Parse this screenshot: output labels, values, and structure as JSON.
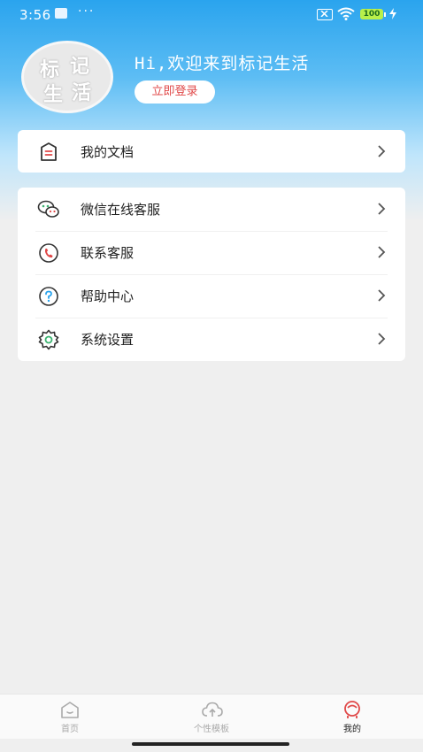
{
  "status_bar": {
    "time": "3:56",
    "dots": "···",
    "battery": "100"
  },
  "header": {
    "avatar_text": [
      "标",
      "记",
      "生",
      "活"
    ],
    "greeting": "Hi,欢迎来到标记生活",
    "login_label": "立即登录"
  },
  "card1": {
    "items": [
      {
        "label": "我的文档",
        "icon": "document-icon"
      }
    ]
  },
  "card2": {
    "items": [
      {
        "label": "微信在线客服",
        "icon": "wechat-icon"
      },
      {
        "label": "联系客服",
        "icon": "phone-icon"
      },
      {
        "label": "帮助中心",
        "icon": "help-icon"
      },
      {
        "label": "系统设置",
        "icon": "gear-icon"
      }
    ]
  },
  "tabbar": {
    "tabs": [
      {
        "label": "首页",
        "icon": "home-icon",
        "active": false
      },
      {
        "label": "个性模板",
        "icon": "cloud-icon",
        "active": false
      },
      {
        "label": "我的",
        "icon": "profile-icon",
        "active": true
      }
    ]
  },
  "colors": {
    "accent": "#e04848",
    "header_blue": "#2aa4ee"
  }
}
